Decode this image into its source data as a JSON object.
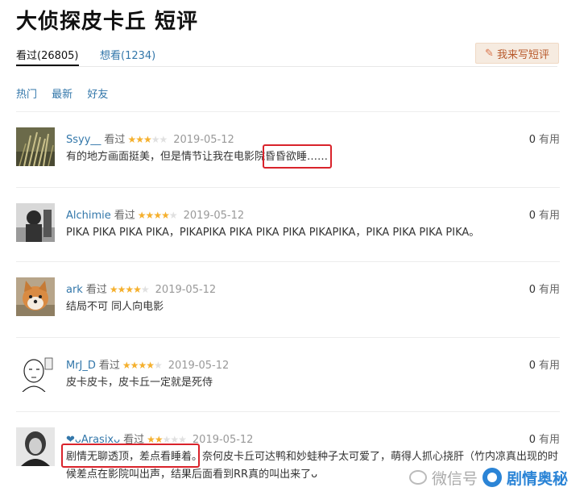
{
  "page": {
    "title": "大侦探皮卡丘 短评",
    "tabs": [
      {
        "label": "看过(26805)"
      },
      {
        "label": "想看(1234)"
      }
    ],
    "write_button_label": "我来写短评",
    "filters": [
      "热门",
      "最新",
      "好友"
    ],
    "useful_label": "有用"
  },
  "reviews": [
    {
      "user": "Ssyy__",
      "status": "看过",
      "rating": 3,
      "date": "2019-05-12",
      "useful_count": "0",
      "text": "有的地方画面挺美，但是情节让我在电影院昏昏欲睡……",
      "avatar": "grass-avatar"
    },
    {
      "user": "Alchimie",
      "status": "看过",
      "rating": 4,
      "date": "2019-05-12",
      "useful_count": "0",
      "text": "PIKA PIKA PIKA PIKA，PIKAPIKA PIKA PIKA PIKA PIKAPIKA，PIKA PIKA PIKA PIKA。",
      "avatar": "dark-figure-avatar"
    },
    {
      "user": "ark",
      "status": "看过",
      "rating": 4,
      "date": "2019-05-12",
      "useful_count": "0",
      "text": "结局不可 同人向电影",
      "avatar": "shiba-dog-avatar"
    },
    {
      "user": "MrJ_D",
      "status": "看过",
      "rating": 4,
      "date": "2019-05-12",
      "useful_count": "0",
      "text": "皮卡皮卡，皮卡丘一定就是死侍",
      "avatar": "saitama-sketch-avatar"
    },
    {
      "user": "❤ᴗArasixᴗ",
      "status": "看过",
      "rating": 2,
      "date": "2019-05-12",
      "useful_count": "0",
      "text": "剧情无聊透顶，差点看睡着。奈何皮卡丘可达鸭和妙蛙种子太可爱了，萌得人抓心挠肝（竹内凉真出现的时候差点在影院叫出声，结果后面看到RR真的叫出来了ᴗ",
      "avatar": "woman-portrait-avatar"
    }
  ],
  "watermark": {
    "prefix": "微信号",
    "brand": "剧情奥秘"
  },
  "colors": {
    "link": "#3377aa",
    "star_on": "#f5b02d",
    "star_off": "#e0e0e0",
    "highlight": "#d9232b",
    "write_button_bg": "#f6ebe0"
  }
}
